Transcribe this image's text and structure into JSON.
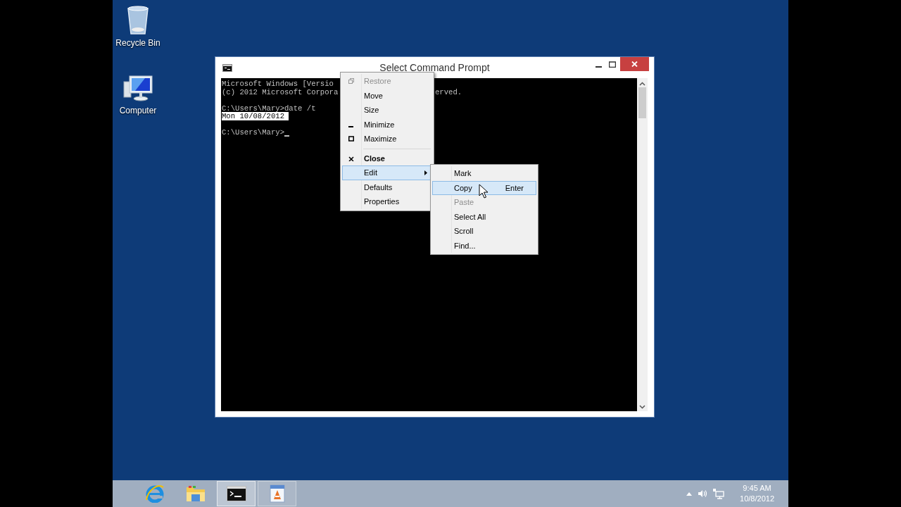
{
  "desktop_icons": [
    {
      "kind": "recycle-bin",
      "label": "Recycle Bin"
    },
    {
      "kind": "computer",
      "label": "Computer"
    }
  ],
  "window": {
    "title": "Select Command Prompt",
    "console_lines": [
      {
        "text": "Microsoft Windows [Versio",
        "highlighted": false
      },
      {
        "text": "(c) 2012 Microsoft Corpora",
        "after_menu": "erved.",
        "highlighted": false
      },
      {
        "text": "C:\\Users\\Mary>date /t",
        "gap_before": true,
        "highlighted": false
      },
      {
        "text": "Mon 10/08/2012 ",
        "highlighted": true
      },
      {
        "text": "C:\\Users\\Mary>",
        "gap_before": true,
        "cursor": true,
        "highlighted": false
      }
    ]
  },
  "system_menu": {
    "items": [
      {
        "kind": "restore",
        "label": "Restore",
        "disabled": true,
        "selected": false
      },
      {
        "kind": "plain",
        "label": "Move",
        "disabled": false,
        "selected": false
      },
      {
        "kind": "plain",
        "label": "Size",
        "disabled": false,
        "selected": false
      },
      {
        "kind": "minimize",
        "label": "Minimize",
        "disabled": false,
        "selected": false
      },
      {
        "kind": "maximize",
        "label": "Maximize",
        "disabled": false,
        "selected": false
      },
      {
        "kind": "separator"
      },
      {
        "kind": "close",
        "label": "Close",
        "bold": true,
        "disabled": false,
        "selected": false
      },
      {
        "kind": "submenu",
        "label": "Edit",
        "disabled": false,
        "selected": true
      },
      {
        "kind": "plain",
        "label": "Defaults",
        "disabled": false,
        "selected": false
      },
      {
        "kind": "plain",
        "label": "Properties",
        "disabled": false,
        "selected": false
      }
    ]
  },
  "edit_submenu": {
    "items": [
      {
        "label": "Mark",
        "disabled": false,
        "selected": false
      },
      {
        "label": "Copy",
        "shortcut": "Enter",
        "disabled": false,
        "selected": true
      },
      {
        "label": "Paste",
        "disabled": true,
        "selected": false
      },
      {
        "label": "Select All",
        "disabled": false,
        "selected": false
      },
      {
        "label": "Scroll",
        "disabled": false,
        "selected": false
      },
      {
        "label": "Find...",
        "disabled": false,
        "selected": false
      }
    ]
  },
  "taskbar": {
    "items": [
      {
        "kind": "browser",
        "running": false,
        "selected": false
      },
      {
        "kind": "folder",
        "running": false,
        "selected": false
      },
      {
        "kind": "terminal",
        "running": true,
        "selected": true
      },
      {
        "kind": "document",
        "running": true,
        "selected": false
      }
    ],
    "clock": {
      "time": "9:45 AM",
      "date": "10/8/2012"
    }
  }
}
